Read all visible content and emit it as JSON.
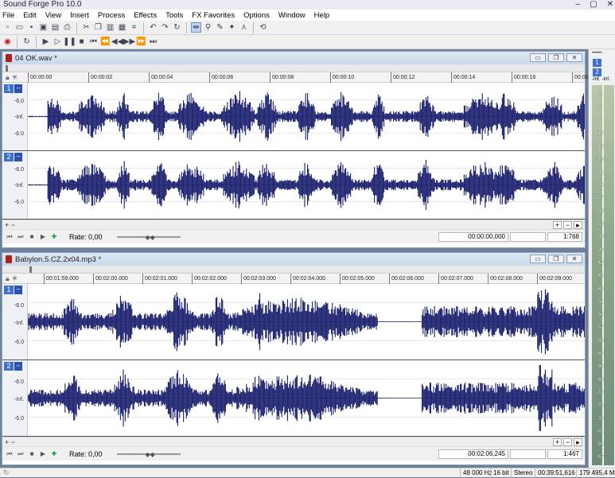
{
  "app": {
    "title": "Sound Forge Pro 10.0",
    "window_controls": [
      "–",
      "▢",
      "✕"
    ]
  },
  "menu": [
    "File",
    "Edit",
    "View",
    "Insert",
    "Process",
    "Effects",
    "Tools",
    "FX Favorites",
    "Options",
    "Window",
    "Help"
  ],
  "toolbar1": [
    "new-icon",
    "open-icon",
    "save-icon",
    "save-all-icon",
    "render-icon",
    "print-icon",
    "cut-icon",
    "copy-icon",
    "paste-icon",
    "mix-icon",
    "crop-icon",
    "undo-icon",
    "redo-icon",
    "repeat-icon",
    "edit-tool-icon",
    "magnify-tool-icon",
    "pencil-tool-icon",
    "event-tool-icon",
    "envelope-tool-icon",
    "zoom-tool-icon"
  ],
  "toolbar2": [
    "record-icon",
    "loop-icon",
    "play-all-icon",
    "play-icon",
    "pause-icon",
    "stop-icon",
    "go-start-icon",
    "prev-marker-icon",
    "rewind-icon",
    "forward-icon",
    "next-marker-icon",
    "go-end-icon"
  ],
  "doc1": {
    "title": "04 OK.wav *",
    "ruler": [
      "00:00:00",
      "00:00:02",
      "00:00:04",
      "00:00:06",
      "00:00:08",
      "00:00:10",
      "00:00:12",
      "00:00:14",
      "00:00:16",
      "00:00:"
    ],
    "ch1": "1",
    "ch2": "2",
    "db_top": "-6.0",
    "db_mid": "-Inf.",
    "db_bot": "-6.0",
    "rate": "Rate: 0,00",
    "position": "00:00:00,000",
    "zoom": "1:768"
  },
  "doc2": {
    "title": "Babylon.5.CZ.2x04.mp3 *",
    "ruler": [
      "00:01:59.000",
      "00:02:00.000",
      "00:02:01.000",
      "00:02:02.000",
      "00:02:03.000",
      "00:02:04.000",
      "00:02:05.000",
      "00:02:06.000",
      "00:02:07.000",
      "00:02:08.000",
      "00:02:09.000"
    ],
    "ch1": "1",
    "ch2": "2",
    "db_top": "-6.0",
    "db_mid": "-Inf.",
    "db_bot": "-6.0",
    "rate": "Rate: 0,00",
    "position": "00:02:06,245",
    "zoom": "1:467"
  },
  "meters": {
    "head": "••••••",
    "ch1": "1",
    "ch2": "2",
    "inf1": "-Inf.",
    "inf2": "-Inf.",
    "scale": [
      "3",
      "6",
      "9",
      "12",
      "15",
      "18",
      "21",
      "24",
      "27",
      "30",
      "33",
      "36",
      "39",
      "42",
      "45",
      "48",
      "51",
      "54",
      "57",
      "60",
      "63",
      "66",
      "69",
      "72",
      "75",
      "78",
      "81",
      "84",
      "87"
    ]
  },
  "status": {
    "sample_rate": "48 000 Hz",
    "bits": "16 bit",
    "channels": "Stereo",
    "length": "00:39:51,616",
    "free_space": "179 495,4 MB"
  },
  "colors": {
    "waveform": "#1a1f6e",
    "accent": "#3c6fd0"
  }
}
